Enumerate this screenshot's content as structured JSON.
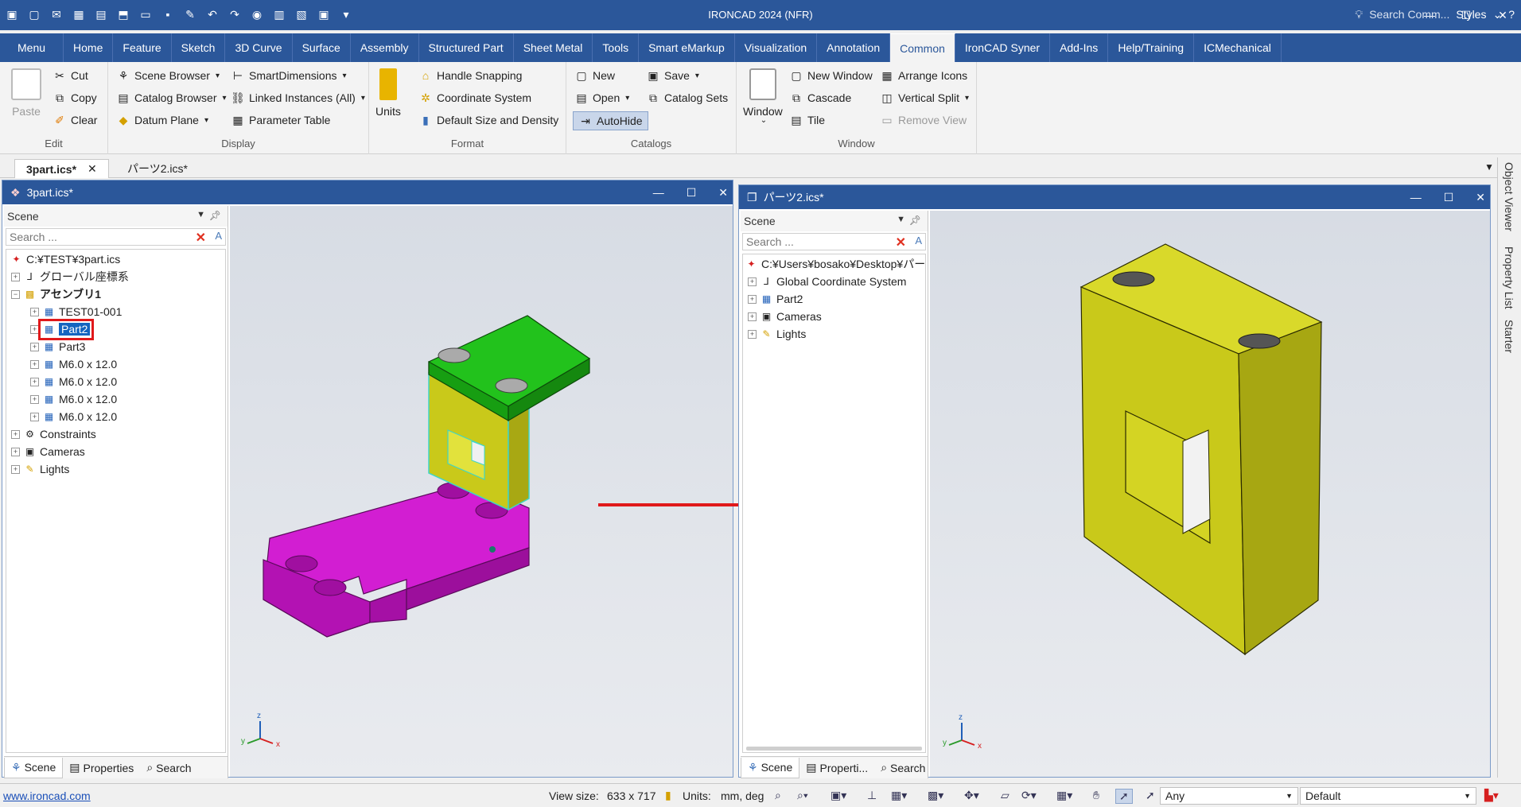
{
  "app": {
    "title": "IRONCAD 2024 (NFR)"
  },
  "qat_icons": [
    "app-icon",
    "new-icon",
    "open-icon",
    "close-icon",
    "print-icon",
    "save-icon",
    "undo-icon",
    "redo-icon"
  ],
  "tabs": [
    "Menu",
    "Home",
    "Feature",
    "Sketch",
    "3D Curve",
    "Surface",
    "Assembly",
    "Structured Part",
    "Sheet Metal",
    "Tools",
    "Smart eMarkup",
    "Visualization",
    "Annotation",
    "Common",
    "IronCAD Syner",
    "Add-Ins",
    "Help/Training",
    "ICMechanical"
  ],
  "active_tab": "Common",
  "search_commands": "Search Comm...",
  "styles": "Styles",
  "ribbon": {
    "edit": {
      "label": "Edit",
      "paste": "Paste",
      "cut": "Cut",
      "copy": "Copy",
      "clear": "Clear"
    },
    "display": {
      "label": "Display",
      "scene_browser": "Scene Browser",
      "catalog_browser": "Catalog Browser",
      "datum_plane": "Datum Plane",
      "smart_dimensions": "SmartDimensions",
      "linked_instances": "Linked Instances (All)",
      "parameter_table": "Parameter Table"
    },
    "format": {
      "label": "Format",
      "units": "Units",
      "handle_snapping": "Handle Snapping",
      "coordinate_system": "Coordinate System",
      "default_size": "Default Size and Density"
    },
    "catalogs": {
      "label": "Catalogs",
      "new": "New",
      "open": "Open",
      "autohide": "AutoHide",
      "save": "Save",
      "catalog_sets": "Catalog Sets"
    },
    "window": {
      "label": "Window",
      "window": "Window",
      "new_window": "New Window",
      "cascade": "Cascade",
      "tile": "Tile",
      "arrange_icons": "Arrange Icons",
      "vertical_split": "Vertical Split",
      "remove_view": "Remove View"
    }
  },
  "doc_tabs": [
    "3part.ics*",
    "パーツ2.ics*"
  ],
  "left_doc": {
    "title": "3part.ics*",
    "scene_label": "Scene",
    "search_placeholder": "Search ...",
    "tree": {
      "root": "C:¥TEST¥3part.ics",
      "global_cs": "グローバル座標系",
      "assembly": "アセンブリ1",
      "children": [
        "TEST01-001",
        "Part2",
        "Part3",
        "M6.0 x 12.0",
        "M6.0 x 12.0",
        "M6.0 x 12.0",
        "M6.0 x 12.0"
      ],
      "constraints": "Constraints",
      "cameras": "Cameras",
      "lights": "Lights"
    },
    "tabs": [
      "Scene",
      "Properties",
      "Search"
    ]
  },
  "right_doc": {
    "title": "パーツ2.ics*",
    "scene_label": "Scene",
    "search_placeholder": "Search ...",
    "tree": {
      "root": "C:¥Users¥bosako¥Desktop¥パー",
      "items": [
        "Global Coordinate System",
        "Part2",
        "Cameras",
        "Lights"
      ]
    },
    "tabs": [
      "Scene",
      "Properti...",
      "Search"
    ]
  },
  "side_panels": [
    "Object Viewer",
    "Property List",
    "Starter"
  ],
  "status": {
    "link": "www.ironcad.com",
    "view_size_label": "View size:",
    "view_size": "633 x 717",
    "units_label": "Units:",
    "units": "mm, deg",
    "filter": "Any",
    "style": "Default"
  },
  "colors": {
    "accent": "#2b579a",
    "green_part": "#22c21c",
    "yellow_part": "#c9c91a",
    "magenta_part": "#d21ed2",
    "highlight": "#e0191b"
  }
}
